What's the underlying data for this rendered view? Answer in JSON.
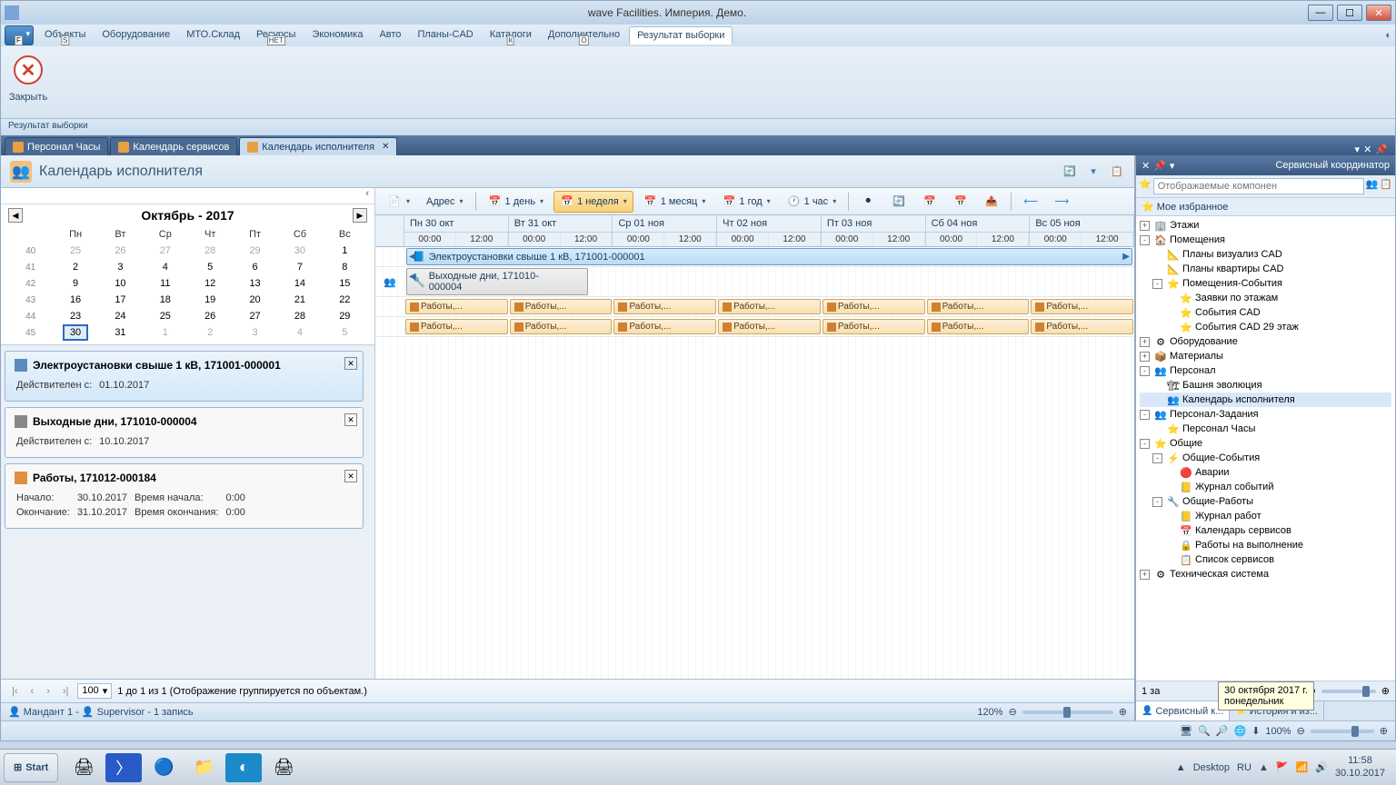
{
  "title": "wave Facilities. Империя. Демо.",
  "menu": {
    "app_key": "F",
    "items": [
      "Объекты",
      "Оборудование",
      "МТО.Склад",
      "Ресурсы",
      "Экономика",
      "Авто",
      "Планы-CAD",
      "Каталоги",
      "Дополнительно",
      "Результат выборки"
    ],
    "keys": {
      "0": "S",
      "3": "НЕТ",
      "7": "К",
      "8": "O"
    },
    "active": 9
  },
  "ribbon": {
    "close": "Закрыть",
    "status": "Результат выборки"
  },
  "tabs": {
    "items": [
      "Персонал Часы",
      "Календарь сервисов",
      "Календарь исполнителя"
    ],
    "active": 2
  },
  "view": {
    "title": "Календарь исполнителя"
  },
  "minical": {
    "title": "Октябрь - 2017",
    "dow": [
      "Пн",
      "Вт",
      "Ср",
      "Чт",
      "Пт",
      "Сб",
      "Вс"
    ],
    "weeks": [
      {
        "wk": "40",
        "d": [
          "25",
          "26",
          "27",
          "28",
          "29",
          "30",
          "1"
        ],
        "dim": [
          0,
          1,
          2,
          3,
          4,
          5
        ]
      },
      {
        "wk": "41",
        "d": [
          "2",
          "3",
          "4",
          "5",
          "6",
          "7",
          "8"
        ]
      },
      {
        "wk": "42",
        "d": [
          "9",
          "10",
          "11",
          "12",
          "13",
          "14",
          "15"
        ]
      },
      {
        "wk": "43",
        "d": [
          "16",
          "17",
          "18",
          "19",
          "20",
          "21",
          "22"
        ]
      },
      {
        "wk": "44",
        "d": [
          "23",
          "24",
          "25",
          "26",
          "27",
          "28",
          "29"
        ]
      },
      {
        "wk": "45",
        "d": [
          "30",
          "31",
          "1",
          "2",
          "3",
          "4",
          "5"
        ],
        "dim": [
          2,
          3,
          4,
          5,
          6
        ],
        "today": 0
      }
    ]
  },
  "cards": [
    {
      "title": "Электроустановки свыше 1 кВ, 171001-000001",
      "rows": [
        [
          "Действителен с:",
          "01.10.2017"
        ]
      ],
      "style": "blue",
      "icon": "blue"
    },
    {
      "title": "Выходные дни, 171010-000004",
      "rows": [
        [
          "Действителен с:",
          "10.10.2017"
        ]
      ],
      "style": "plain",
      "icon": "grey"
    },
    {
      "title": "Работы, 171012-000184",
      "rows": [
        [
          "Начало:",
          "30.10.2017",
          "Время начала:",
          "0:00"
        ],
        [
          "Окончание:",
          "31.10.2017",
          "Время окончания:",
          "0:00"
        ]
      ],
      "style": "plain",
      "icon": "orange"
    }
  ],
  "sched_tb": {
    "address": "Адрес",
    "day": "1 день",
    "week": "1 неделя",
    "month": "1 месяц",
    "year": "1 год",
    "hour": "1 час"
  },
  "timeline": {
    "days": [
      "Пн 30 окт",
      "Вт 31 окт",
      "Ср 01 ноя",
      "Чт 02 ноя",
      "Пт 03 ноя",
      "Сб 04 ноя",
      "Вс 05 ноя"
    ],
    "hours": [
      "00:00",
      "12:00"
    ],
    "bars": [
      {
        "type": "full",
        "label": "Электроустановки свыше 1 кВ, 171001-000001",
        "icon": "📘"
      },
      {
        "type": "full",
        "label": "Выходные дни, 171010-000004",
        "icon": "🔧",
        "short": true
      }
    ],
    "task_label": "Работы,..."
  },
  "pager": {
    "size": "100",
    "info": "1 до 1 из 1 (Отображение группируется по объектам.)"
  },
  "statusbar": {
    "left": "Мандант 1 -",
    "user": "Supervisor - 1 запись",
    "zoom": "120%"
  },
  "side": {
    "title": "Сервисный координатор",
    "placeholder": "Отображаемые компонен",
    "fav": "Мое избранное",
    "tree": [
      {
        "l": 0,
        "t": "+",
        "i": "🏢",
        "txt": "Этажи"
      },
      {
        "l": 0,
        "t": "-",
        "i": "🏠",
        "txt": "Помещения"
      },
      {
        "l": 1,
        "t": "",
        "i": "📐",
        "txt": "Планы визуализ CAD"
      },
      {
        "l": 1,
        "t": "",
        "i": "📐",
        "txt": "Планы квартиры CAD"
      },
      {
        "l": 1,
        "t": "-",
        "i": "⭐",
        "txt": "Помещения-События"
      },
      {
        "l": 2,
        "t": "",
        "i": "⭐",
        "txt": "Заявки по этажам"
      },
      {
        "l": 2,
        "t": "",
        "i": "⭐",
        "txt": "События CAD"
      },
      {
        "l": 2,
        "t": "",
        "i": "⭐",
        "txt": "События CAD 29 этаж"
      },
      {
        "l": 0,
        "t": "+",
        "i": "⚙",
        "txt": "Оборудование"
      },
      {
        "l": 0,
        "t": "+",
        "i": "📦",
        "txt": "Материалы"
      },
      {
        "l": 0,
        "t": "-",
        "i": "👥",
        "txt": "Персонал"
      },
      {
        "l": 1,
        "t": "",
        "i": "🏗",
        "txt": "Башня эволюция"
      },
      {
        "l": 1,
        "t": "",
        "i": "👥",
        "txt": "Календарь исполнителя",
        "sel": true
      },
      {
        "l": 0,
        "t": "-",
        "i": "👥",
        "txt": "Персонал-Задания"
      },
      {
        "l": 1,
        "t": "",
        "i": "⭐",
        "txt": "Персонал Часы"
      },
      {
        "l": 0,
        "t": "-",
        "i": "⭐",
        "txt": "Общие"
      },
      {
        "l": 1,
        "t": "-",
        "i": "⚡",
        "txt": "Общие-События"
      },
      {
        "l": 2,
        "t": "",
        "i": "🔴",
        "txt": "Аварии"
      },
      {
        "l": 2,
        "t": "",
        "i": "📒",
        "txt": "Журнал событий"
      },
      {
        "l": 1,
        "t": "-",
        "i": "🔧",
        "txt": "Общие-Работы"
      },
      {
        "l": 2,
        "t": "",
        "i": "📒",
        "txt": "Журнал работ"
      },
      {
        "l": 2,
        "t": "",
        "i": "📅",
        "txt": "Календарь сервисов"
      },
      {
        "l": 2,
        "t": "",
        "i": "🔒",
        "txt": "Работы на выполнение"
      },
      {
        "l": 2,
        "t": "",
        "i": "📋",
        "txt": "Список сервисов"
      },
      {
        "l": 0,
        "t": "+",
        "i": "⚙",
        "txt": "Техническая система"
      }
    ],
    "footer": {
      "label": "1 за",
      "zoom": "100%"
    },
    "tabs": [
      "Сервисный к...",
      "История и из..."
    ]
  },
  "lower_status": {
    "zoom": "100%"
  },
  "tooltip": {
    "line1": "30 октября 2017 г.",
    "line2": "понедельник"
  },
  "taskbar": {
    "start": "Start",
    "desktop": "Desktop",
    "lang": "RU",
    "time": "11:58",
    "date": "30.10.2017"
  }
}
